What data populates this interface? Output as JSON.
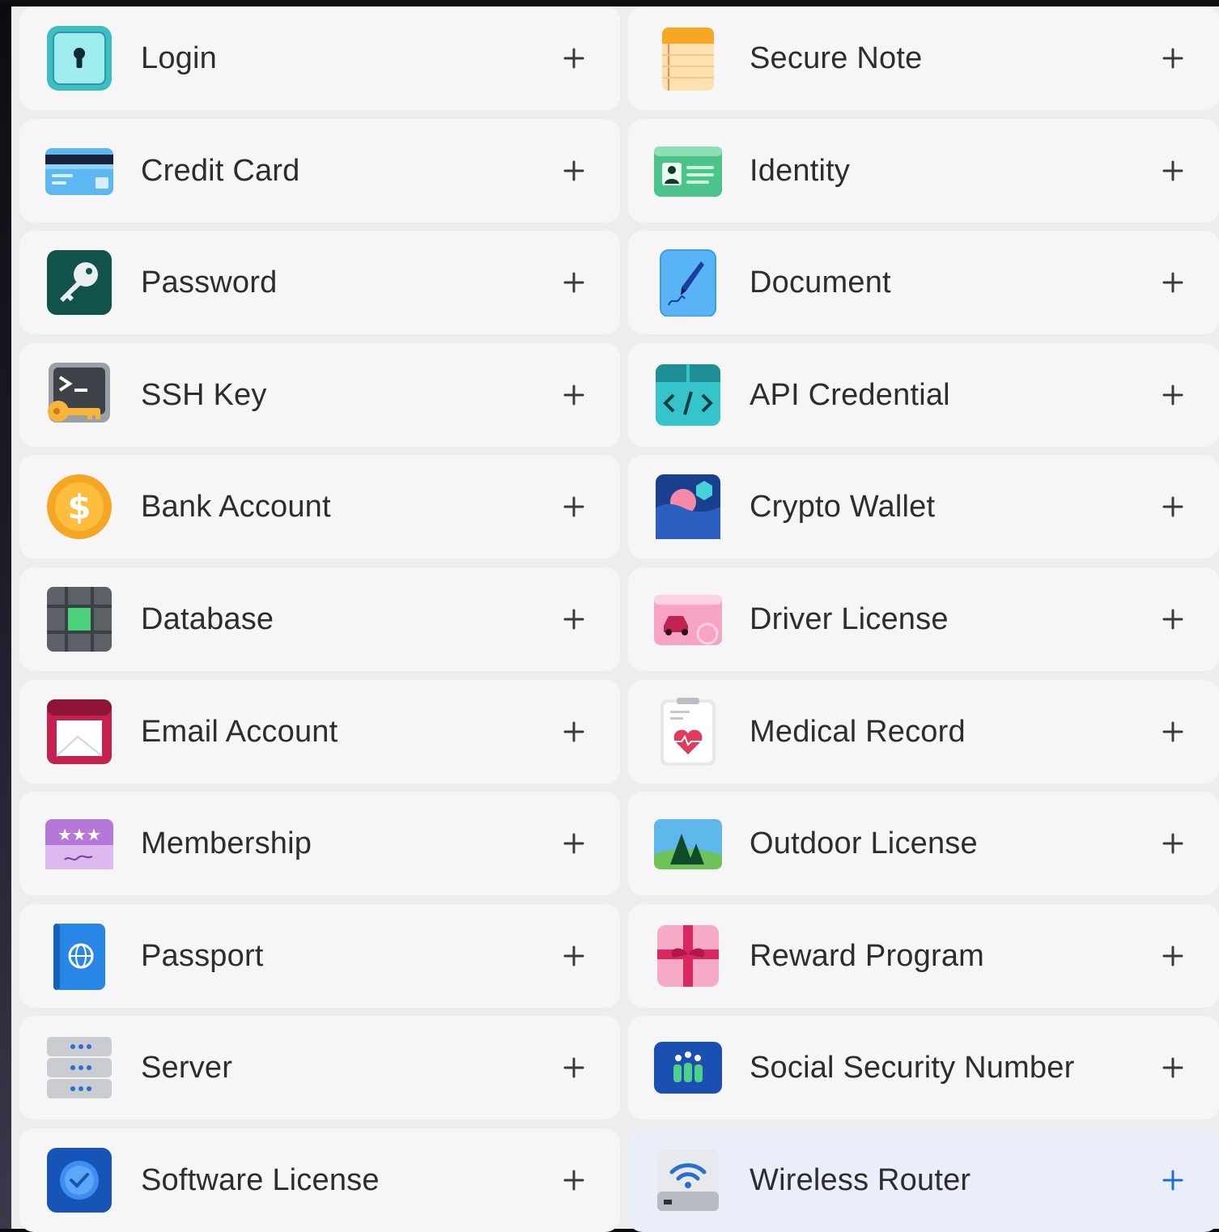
{
  "items": [
    {
      "label": "Login",
      "icon": "login-icon"
    },
    {
      "label": "Secure Note",
      "icon": "secure-note-icon"
    },
    {
      "label": "Credit Card",
      "icon": "credit-card-icon"
    },
    {
      "label": "Identity",
      "icon": "identity-icon"
    },
    {
      "label": "Password",
      "icon": "password-key-icon"
    },
    {
      "label": "Document",
      "icon": "document-icon"
    },
    {
      "label": "SSH Key",
      "icon": "ssh-key-icon"
    },
    {
      "label": "API Credential",
      "icon": "api-credential-icon"
    },
    {
      "label": "Bank Account",
      "icon": "bank-account-icon"
    },
    {
      "label": "Crypto Wallet",
      "icon": "crypto-wallet-icon"
    },
    {
      "label": "Database",
      "icon": "database-icon"
    },
    {
      "label": "Driver License",
      "icon": "driver-license-icon"
    },
    {
      "label": "Email Account",
      "icon": "email-account-icon"
    },
    {
      "label": "Medical Record",
      "icon": "medical-record-icon"
    },
    {
      "label": "Membership",
      "icon": "membership-icon"
    },
    {
      "label": "Outdoor License",
      "icon": "outdoor-license-icon"
    },
    {
      "label": "Passport",
      "icon": "passport-icon"
    },
    {
      "label": "Reward Program",
      "icon": "reward-program-icon"
    },
    {
      "label": "Server",
      "icon": "server-icon"
    },
    {
      "label": "Social Security Number",
      "icon": "social-security-number-icon"
    },
    {
      "label": "Software License",
      "icon": "software-license-icon"
    },
    {
      "label": "Wireless Router",
      "icon": "wireless-router-icon",
      "active": true
    }
  ],
  "colors": {
    "plus": "#3a3a3a",
    "active_plus": "#1f6ed4",
    "active_bg": "#e9eef8"
  }
}
